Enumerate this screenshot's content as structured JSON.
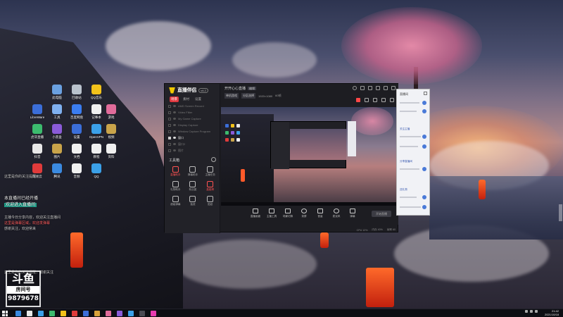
{
  "desktop": {
    "icons": [
      {
        "label": "此电脑",
        "color": "#6aa0e0"
      },
      {
        "label": "回收站",
        "color": "#b9c2cc"
      },
      {
        "label": "QQ音乐",
        "color": "#f2c21a"
      },
      {
        "label": "LibreWare",
        "color": "#3b6ed8"
      },
      {
        "label": "工具",
        "color": "#7fb0f0"
      },
      {
        "label": "百度网盘",
        "color": "#3b7df0"
      },
      {
        "label": "记事本",
        "color": "#f0f0f0"
      },
      {
        "label": "虎牙直播",
        "color": "#3cbb6e"
      },
      {
        "label": "小黑盒",
        "color": "#8a5bd8"
      },
      {
        "label": "设置",
        "color": "#3b6ed8"
      },
      {
        "label": "OpenVPN",
        "color": "#3ba0e8"
      },
      {
        "label": "游戏",
        "color": "#e06b9a"
      },
      {
        "label": "抖音",
        "color": "#e8e8e8"
      },
      {
        "label": "图片",
        "color": "#c9a44a"
      },
      {
        "label": "文档",
        "color": "#f0f0f0"
      },
      {
        "label": "教程",
        "color": "#f0f0f0"
      },
      {
        "label": "视频",
        "color": "#c9a44a"
      },
      {
        "label": "网易云",
        "color": "#e03b3b"
      },
      {
        "label": "腾讯",
        "color": "#3b8ae0"
      },
      {
        "label": "音频",
        "color": "#f0f0f0"
      },
      {
        "label": "QQ",
        "color": "#3ba0e8"
      },
      {
        "label": "资料",
        "color": "#f0f0f0"
      }
    ],
    "overlay_lines": [
      "这里是你的关注提醒",
      "本直播间已经开播",
      "欢迎进入直播间",
      "主播今日分享内容，欢迎关注直播间",
      "这里是弹幕区域，欢迎发弹幕",
      "感谢关注，欢迎常来",
      "这里是你的关注提醒，谢谢关注"
    ],
    "logo": {
      "big": "斗鱼",
      "mid": "房间号",
      "num": "9879678"
    }
  },
  "app": {
    "brand": "直播伴侣",
    "version": "v4.2",
    "tabs": [
      "场景",
      "素材",
      "设置"
    ],
    "sources": [
      {
        "label": "AMD Screen Record",
        "on": false
      },
      {
        "label": "Video Filter",
        "on": false
      },
      {
        "label": "My Game Capture",
        "on": false
      },
      {
        "label": "Display Capture",
        "on": false
      },
      {
        "label": "Window Capture Program",
        "on": false
      },
      {
        "label": "窗口",
        "on": true
      },
      {
        "label": "窗口2",
        "on": false
      },
      {
        "label": "图片",
        "on": false
      }
    ],
    "tools_title": "工具箱",
    "tools": [
      {
        "label": "直播助手",
        "hot": true
      },
      {
        "label": "弹幕助手",
        "hot": false
      },
      {
        "label": "主播任务",
        "hot": false
      },
      {
        "label": "礼物助手",
        "hot": false
      },
      {
        "label": "粉丝团",
        "hot": false
      },
      {
        "label": "高能榜",
        "hot": true
      },
      {
        "label": "超级弹幕",
        "hot": false
      },
      {
        "label": "抽奖",
        "hot": false
      },
      {
        "label": "贴纸",
        "hot": false
      },
      {
        "label": "画质",
        "hot": false
      },
      {
        "label": "音乐",
        "hot": false
      },
      {
        "label": "更多",
        "hot": false
      }
    ],
    "main": {
      "title": "开开心心直播",
      "title_tag": "编辑",
      "meta_pills": [
        "单机游戏",
        "分区选择"
      ],
      "meta_text": [
        "1920×1080",
        "60帧"
      ],
      "bottom_buttons": [
        "直播画面",
        "主播工具",
        "场景切换",
        "录屏",
        "音量",
        "麦克风",
        "弹幕"
      ],
      "go_live": "开始直播",
      "status": [
        "CPU 12%",
        "内存 40%",
        "帧率 60"
      ]
    },
    "chat": {
      "title": "直播间",
      "links": [
        "关注主播",
        "分享直播间",
        "送礼物"
      ]
    }
  },
  "taskbar": {
    "time": "21:42",
    "date": "2021/10/18",
    "icons": [
      "#3b8ae0",
      "#e8e8e8",
      "#3ba0e8",
      "#3cbb6e",
      "#f2c21a",
      "#e03b3b",
      "#3b6ed8",
      "#d8a23a",
      "#e06b9a",
      "#8a5bd8",
      "#3ba0e8",
      "#4a4a52",
      "#e83bb0"
    ]
  }
}
